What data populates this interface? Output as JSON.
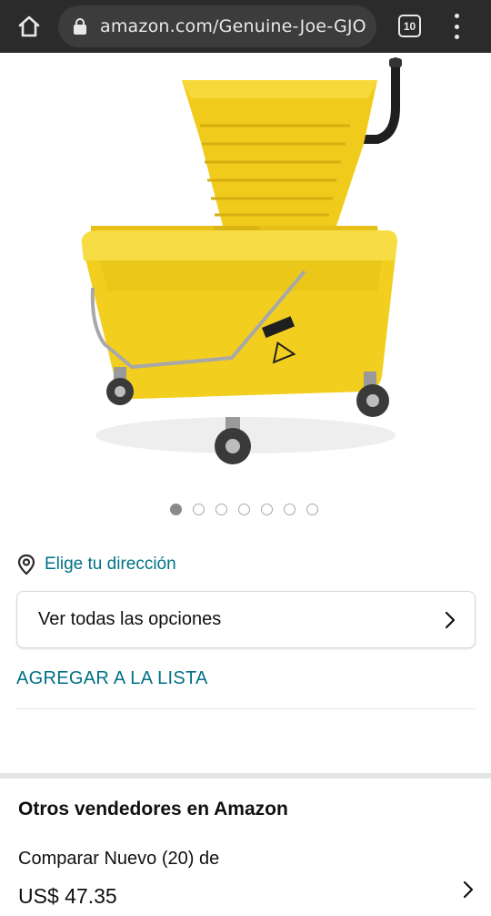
{
  "browser": {
    "url": "amazon.com/Genuine-Joe-GJO",
    "tab_count": "10",
    "home_icon": "home-icon",
    "lock_icon": "lock-icon",
    "menu_icon": "kebab-menu-icon"
  },
  "product": {
    "image_icon": "mop-bucket-wringer-image",
    "carousel": {
      "total": 7,
      "active_index": 0
    }
  },
  "delivery": {
    "icon": "location-pin-icon",
    "label": "Elige tu dirección"
  },
  "options_button": {
    "label": "Ver todas las opciones",
    "icon": "chevron-right-icon"
  },
  "add_to_list": {
    "label": "AGREGAR A LA LISTA"
  },
  "other_sellers": {
    "title": "Otros vendedores en Amazon",
    "compare_label": "Comparar Nuevo (20) de",
    "price": "US$ 47.35",
    "icon": "chevron-right-icon"
  },
  "colors": {
    "topbar": "#2b2b2b",
    "link": "#007185",
    "text": "#0f1111",
    "bucket_yellow": "#f2cf1f"
  }
}
